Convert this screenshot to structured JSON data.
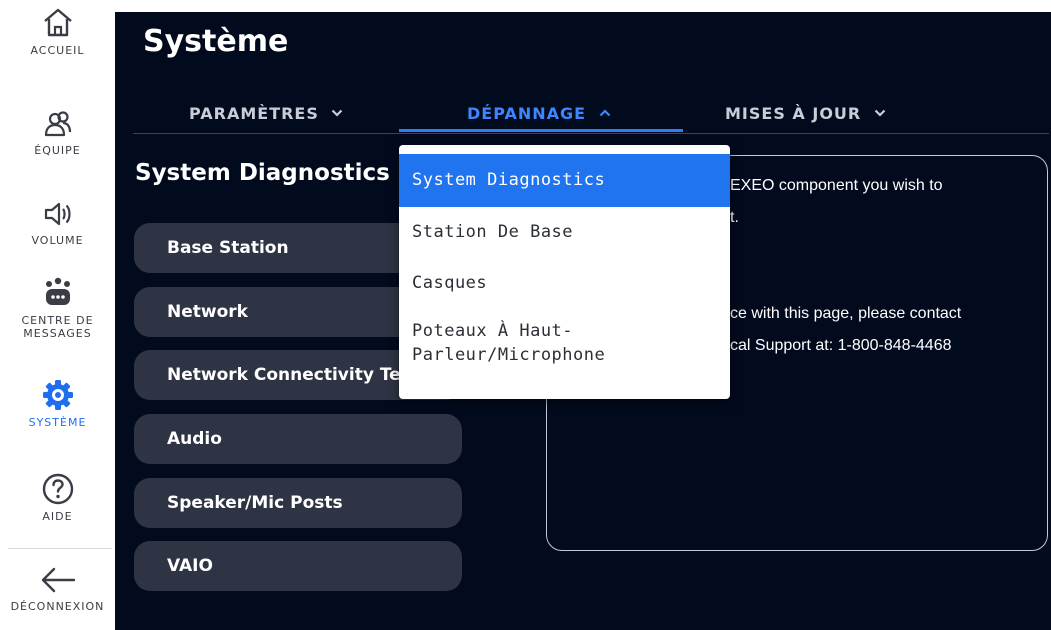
{
  "sidebar": {
    "items": [
      {
        "label": "ACCUEIL",
        "icon": "home-icon"
      },
      {
        "label": "ÉQUIPE",
        "icon": "team-icon"
      },
      {
        "label": "VOLUME",
        "icon": "volume-icon"
      },
      {
        "label": "CENTRE DE\nMESSAGES",
        "icon": "message-center-icon"
      },
      {
        "label": "SYSTÈME",
        "icon": "gear-icon",
        "active": true
      },
      {
        "label": "AIDE",
        "icon": "help-icon"
      },
      {
        "label": "DÉCONNEXION",
        "icon": "back-arrow-icon"
      }
    ]
  },
  "header": {
    "title": "Système",
    "tabs": [
      {
        "label": "PARAMÈTRES",
        "chevron": "down"
      },
      {
        "label": "DÉPANNAGE",
        "chevron": "up",
        "active": true
      },
      {
        "label": "MISES À JOUR",
        "chevron": "down"
      }
    ]
  },
  "main": {
    "section_title": "System Diagnostics",
    "diagnostics": [
      "Base Station",
      "Network",
      "Network Connectivity Test",
      "Audio",
      "Speaker/Mic Posts",
      "VAIO"
    ],
    "info_lines": [
      "EXEO component you wish to",
      "t.",
      "ce with this page, please contact",
      "cal Support at: 1-800-848-4468"
    ]
  },
  "dropdown": {
    "items": [
      {
        "label": "System Diagnostics",
        "selected": true
      },
      {
        "label": "Station De Base"
      },
      {
        "label": "Casques"
      },
      {
        "label": "Poteaux À Haut-\nParleur/Microphone"
      }
    ]
  },
  "colors": {
    "background": "#020a1e",
    "accent": "#2f7cf6",
    "button": "#2e3443",
    "sidebar_active": "#1e6ef2"
  }
}
